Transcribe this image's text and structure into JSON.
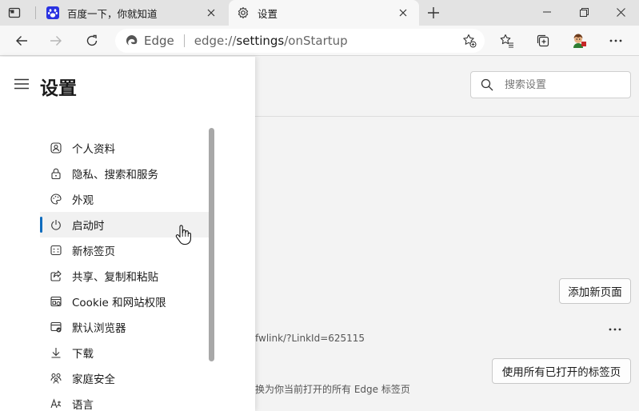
{
  "tabs": [
    {
      "title": "百度一下，你就知道",
      "favicon": "baidu-paw-icon",
      "active": false
    },
    {
      "title": "设置",
      "favicon": "gear-icon",
      "active": true
    }
  ],
  "toolbar": {
    "address_brand": "Edge",
    "url_prefix": "edge://",
    "url_main": "settings",
    "url_suffix": "/onStartup"
  },
  "settings": {
    "title": "设置",
    "search_placeholder": "搜索设置",
    "nav": [
      {
        "label": "个人资料",
        "icon": "profile-icon"
      },
      {
        "label": "隐私、搜索和服务",
        "icon": "lock-icon"
      },
      {
        "label": "外观",
        "icon": "palette-icon"
      },
      {
        "label": "启动时",
        "icon": "power-icon",
        "selected": true
      },
      {
        "label": "新标签页",
        "icon": "new-tab-page-icon"
      },
      {
        "label": "共享、复制和粘贴",
        "icon": "share-icon"
      },
      {
        "label": "Cookie 和网站权限",
        "icon": "site-permissions-icon"
      },
      {
        "label": "默认浏览器",
        "icon": "default-browser-icon"
      },
      {
        "label": "下载",
        "icon": "download-icon"
      },
      {
        "label": "家庭安全",
        "icon": "family-icon"
      },
      {
        "label": "语言",
        "icon": "language-icon"
      }
    ],
    "add_page_button": "添加新页面",
    "link_fragment": "fwlink/?LinkId=625115",
    "use_all_tabs_button": "使用所有已打开的标签页",
    "replace_desc": "换为你当前打开的所有 Edge 标签页"
  }
}
